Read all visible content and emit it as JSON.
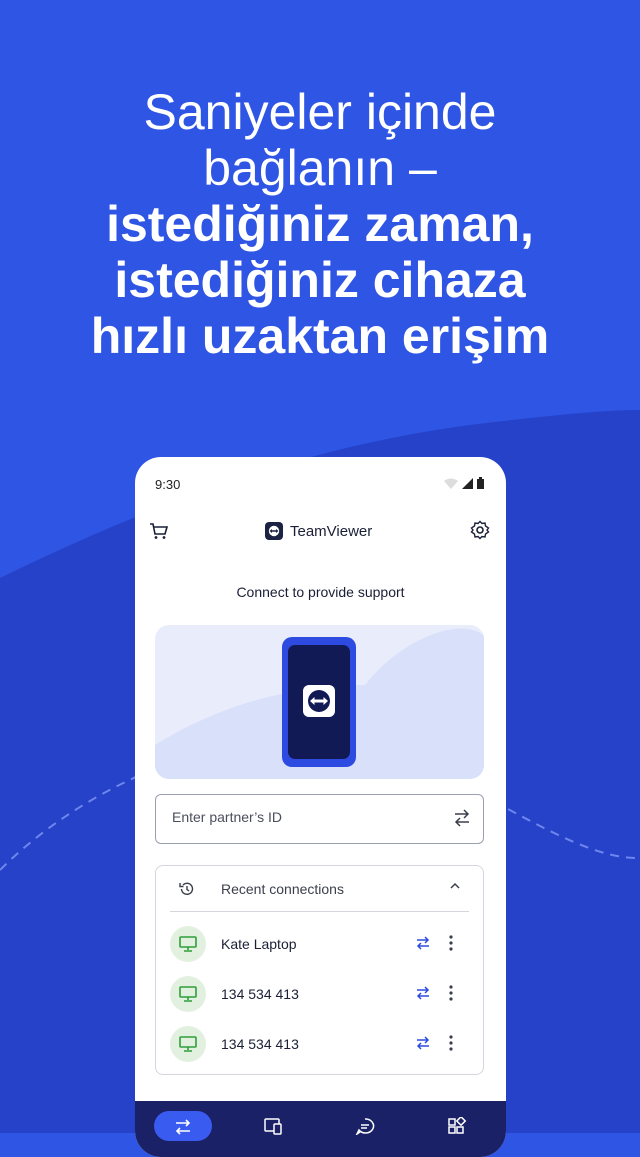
{
  "colors": {
    "brand_blue": "#2f55e4",
    "navy": "#1b2166",
    "device_green": "#2e9e3a"
  },
  "headline": {
    "line1": "Saniyeler içinde",
    "line2": "bağlanın –",
    "line3": "istediğiniz zaman,",
    "line4": "istediğiniz cihaza",
    "line5": "hızlı uzaktan erişim"
  },
  "status_bar": {
    "time": "9:30"
  },
  "app_bar": {
    "title": "TeamViewer"
  },
  "main": {
    "connect_text": "Connect to provide support",
    "partner_input": {
      "placeholder": "Enter partner’s ID",
      "value": ""
    }
  },
  "recent": {
    "title": "Recent connections",
    "items": [
      {
        "name": "Kate Laptop"
      },
      {
        "name": "134 534 413"
      },
      {
        "name": "134 534 413"
      }
    ]
  },
  "bottom_nav": {
    "items": [
      {
        "icon": "connect-icon",
        "active": true
      },
      {
        "icon": "devices-icon",
        "active": false
      },
      {
        "icon": "chat-icon",
        "active": false
      },
      {
        "icon": "apps-icon",
        "active": false
      }
    ]
  }
}
